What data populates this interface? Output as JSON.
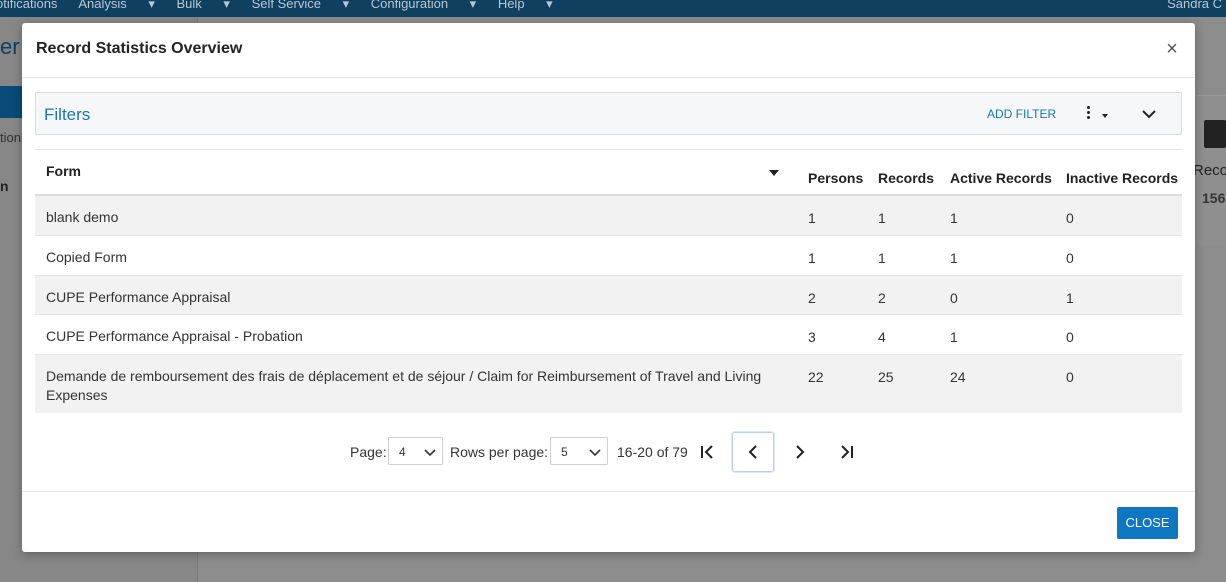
{
  "background": {
    "nav_items": [
      "otifications",
      "Analysis",
      "Bulk",
      "Self Service",
      "Configuration",
      "Help"
    ],
    "user": "Sandra C",
    "heading_fragment": "er",
    "label_a": "tion",
    "label_b": "n",
    "card_title": "Reco",
    "card_value": "156"
  },
  "modal": {
    "title": "Record Statistics Overview",
    "close_glyph": "×"
  },
  "filters": {
    "title": "Filters",
    "add_filter_label": "ADD FILTER"
  },
  "table": {
    "columns": {
      "form": "Form",
      "persons": "Persons",
      "records": "Records",
      "active": "Active Records",
      "inactive": "Inactive Records"
    },
    "rows": [
      {
        "form": "blank demo",
        "persons": "1",
        "records": "1",
        "active": "1",
        "inactive": "0"
      },
      {
        "form": "Copied Form",
        "persons": "1",
        "records": "1",
        "active": "1",
        "inactive": "0"
      },
      {
        "form": "CUPE Performance Appraisal",
        "persons": "2",
        "records": "2",
        "active": "0",
        "inactive": "1"
      },
      {
        "form": "CUPE Performance Appraisal - Probation",
        "persons": "3",
        "records": "4",
        "active": "1",
        "inactive": "0"
      },
      {
        "form": "Demande de remboursement des frais de déplacement et de séjour / Claim for Reimbursement of Travel and Living Expenses",
        "persons": "22",
        "records": "25",
        "active": "24",
        "inactive": "0"
      }
    ]
  },
  "pagination": {
    "page_label": "Page:",
    "page_value": "4",
    "rows_label": "Rows per page:",
    "rows_value": "5",
    "range_text": "16-20 of 79"
  },
  "footer": {
    "close_label": "CLOSE"
  },
  "colors": {
    "accent": "#0d77c1",
    "link": "#1b76b5",
    "nav": "#0f4060"
  }
}
